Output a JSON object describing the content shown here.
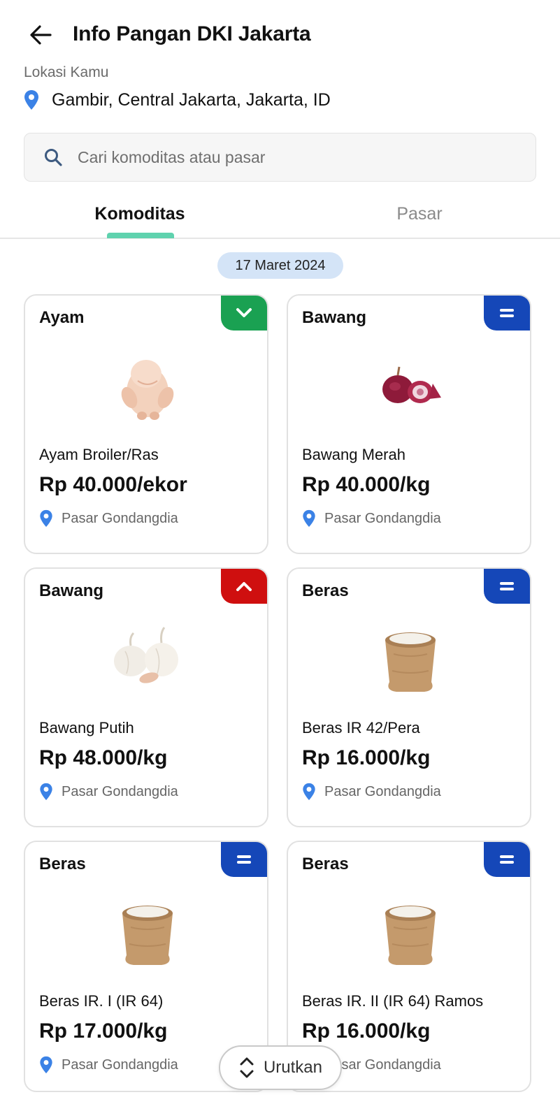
{
  "header": {
    "title": "Info Pangan DKI Jakarta"
  },
  "location": {
    "label": "Lokasi Kamu",
    "value": "Gambir, Central Jakarta, Jakarta, ID"
  },
  "search": {
    "placeholder": "Cari komoditas atau pasar"
  },
  "tabs": [
    {
      "label": "Komoditas",
      "active": true
    },
    {
      "label": "Pasar",
      "active": false
    }
  ],
  "date": "17 Maret 2024",
  "colors": {
    "accent": "#5fd2ae",
    "trend_down": "#1aa152",
    "trend_up": "#cf0f0f",
    "trend_same": "#1547b8",
    "pin": "#3b82e6"
  },
  "cards": [
    {
      "category": "Ayam",
      "trend": "down",
      "trend_icon": "chevron-down-icon",
      "image": "chicken-image",
      "name": "Ayam Broiler/Ras",
      "price": "Rp 40.000/ekor",
      "market": "Pasar Gondangdia"
    },
    {
      "category": "Bawang",
      "trend": "same",
      "trend_icon": "equals-icon",
      "image": "red-onion-image",
      "name": "Bawang Merah",
      "price": "Rp 40.000/kg",
      "market": "Pasar Gondangdia"
    },
    {
      "category": "Bawang",
      "trend": "up",
      "trend_icon": "chevron-up-icon",
      "image": "garlic-image",
      "name": "Bawang Putih",
      "price": "Rp 48.000/kg",
      "market": "Pasar Gondangdia"
    },
    {
      "category": "Beras",
      "trend": "same",
      "trend_icon": "equals-icon",
      "image": "rice-sack-image",
      "name": "Beras IR 42/Pera",
      "price": "Rp 16.000/kg",
      "market": "Pasar Gondangdia"
    },
    {
      "category": "Beras",
      "trend": "same",
      "trend_icon": "equals-icon",
      "image": "rice-sack-image",
      "name": "Beras IR. I (IR 64)",
      "price": "Rp 17.000/kg",
      "market": "Pasar Gondangdia"
    },
    {
      "category": "Beras",
      "trend": "same",
      "trend_icon": "equals-icon",
      "image": "rice-sack-image",
      "name": "Beras IR. II (IR 64) Ramos",
      "price": "Rp 16.000/kg",
      "market": "Pasar Gondangdia"
    }
  ],
  "sort": {
    "label": "Urutkan",
    "icon": "sort-icon"
  }
}
